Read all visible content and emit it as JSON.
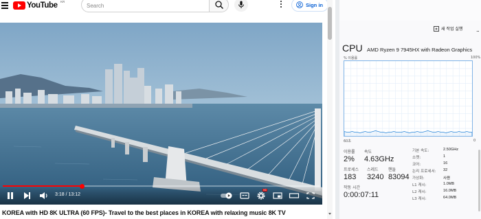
{
  "youtube": {
    "logo_text": "YouTube",
    "logo_region": "KR",
    "search": {
      "placeholder": "Search",
      "value": ""
    },
    "signin_label": "Sign in",
    "player": {
      "time_current": "3:18",
      "time_separator": " / ",
      "time_total": "13:12",
      "progress_fraction": 0.25,
      "settings_badge": "HD"
    },
    "video_title": "KOREA with HD 8K ULTRA (60 FPS)- Travel to the best places in KOREA with relaxing music 8K TV"
  },
  "task_manager": {
    "toolbar": {
      "new_task_label": "새 작업 실행",
      "more_label": "..."
    },
    "cpu": {
      "heading": "CPU",
      "model": "AMD Ryzen 9 7945HX with Radeon Graphics",
      "graph_label": "% 이용률",
      "graph_max": "100%",
      "graph_time": "60초",
      "graph_min": "0",
      "utilization_history": [
        6,
        5,
        5,
        6,
        5,
        5,
        4,
        5,
        6,
        5,
        5,
        6,
        7,
        6,
        5,
        5,
        4,
        5,
        5,
        6,
        5,
        5,
        5,
        6,
        5,
        4,
        5,
        5,
        6,
        5,
        5,
        6,
        7,
        6,
        5,
        5,
        6,
        5,
        5,
        4,
        5,
        6,
        5,
        5,
        6,
        5,
        5,
        6,
        5,
        5
      ]
    },
    "stats": {
      "utilization": {
        "label": "이용률",
        "value": "2%"
      },
      "speed": {
        "label": "속도",
        "value": "4.63GHz"
      },
      "processes": {
        "label": "프로세스",
        "value": "183"
      },
      "threads": {
        "label": "스레드",
        "value": "3240"
      },
      "handles": {
        "label": "핸들",
        "value": "83094"
      },
      "uptime": {
        "label": "작동 시간",
        "value": "0:00:07:11"
      }
    },
    "details": [
      {
        "label": "기본 속도:",
        "value": "2.50GHz"
      },
      {
        "label": "소켓:",
        "value": "1"
      },
      {
        "label": "코어:",
        "value": "16"
      },
      {
        "label": "논리 프로세서:",
        "value": "32"
      },
      {
        "label": "가상화:",
        "value": "사용"
      },
      {
        "label": "L1 캐시:",
        "value": "1.0MB"
      },
      {
        "label": "L2 캐시:",
        "value": "16.0MB"
      },
      {
        "label": "L3 캐시:",
        "value": "64.0MB"
      }
    ]
  },
  "colors": {
    "youtube_red": "#ff0000",
    "link_blue": "#065fd4",
    "graph_line": "#2a85d8",
    "graph_border": "#7fb3e6"
  }
}
